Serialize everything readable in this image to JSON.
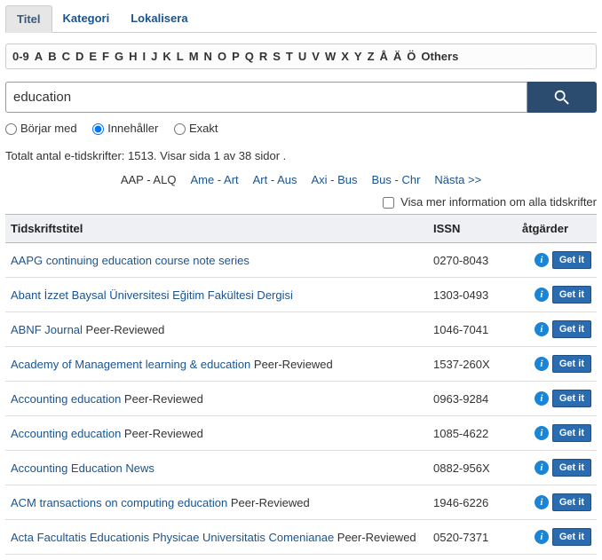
{
  "tabs": {
    "active": "Titel",
    "items": [
      "Titel",
      "Kategori",
      "Lokalisera"
    ]
  },
  "alpha": [
    "0-9",
    "A",
    "B",
    "C",
    "D",
    "E",
    "F",
    "G",
    "H",
    "I",
    "J",
    "K",
    "L",
    "M",
    "N",
    "O",
    "P",
    "Q",
    "R",
    "S",
    "T",
    "U",
    "V",
    "W",
    "X",
    "Y",
    "Z",
    "Å",
    "Ä",
    "Ö",
    "Others"
  ],
  "search": {
    "value": "education",
    "button_aria": "Search"
  },
  "filters": {
    "borjar": "Börjar med",
    "innehaller": "Innehåller",
    "exakt": "Exakt",
    "selected": "innehaller"
  },
  "status": "Totalt antal e-tidskrifter: 1513. Visar sida 1 av 38 sidor .",
  "pager": {
    "current": "AAP - ALQ",
    "items": [
      "Ame - Art",
      "Art - Aus",
      "Axi - Bus",
      "Bus - Chr"
    ],
    "next": "Nästa >>"
  },
  "toggle_label": "Visa mer information om alla tidskrifter",
  "headers": {
    "title": "Tidskriftstitel",
    "issn": "ISSN",
    "actions": "åtgärder"
  },
  "getit_label": "Get it",
  "peer_label": "Peer-Reviewed",
  "rows": [
    {
      "title": "AAPG continuing education course note series",
      "peer": false,
      "issn": "0270-8043"
    },
    {
      "title": "Abant İzzet Baysal Üniversitesi Eğitim Fakültesi Dergisi",
      "peer": false,
      "issn": "1303-0493"
    },
    {
      "title": "ABNF Journal",
      "peer": true,
      "issn": "1046-7041"
    },
    {
      "title": "Academy of Management learning & education",
      "peer": true,
      "issn": "1537-260X"
    },
    {
      "title": "Accounting education",
      "peer": true,
      "issn": "0963-9284"
    },
    {
      "title": "Accounting education",
      "peer": true,
      "issn": "1085-4622"
    },
    {
      "title": "Accounting Education News",
      "peer": false,
      "issn": "0882-956X"
    },
    {
      "title": "ACM transactions on computing education",
      "peer": true,
      "issn": "1946-6226"
    },
    {
      "title": "Acta Facultatis Educationis Physicae Universitatis Comenianae",
      "peer": true,
      "issn": "0520-7371"
    }
  ]
}
